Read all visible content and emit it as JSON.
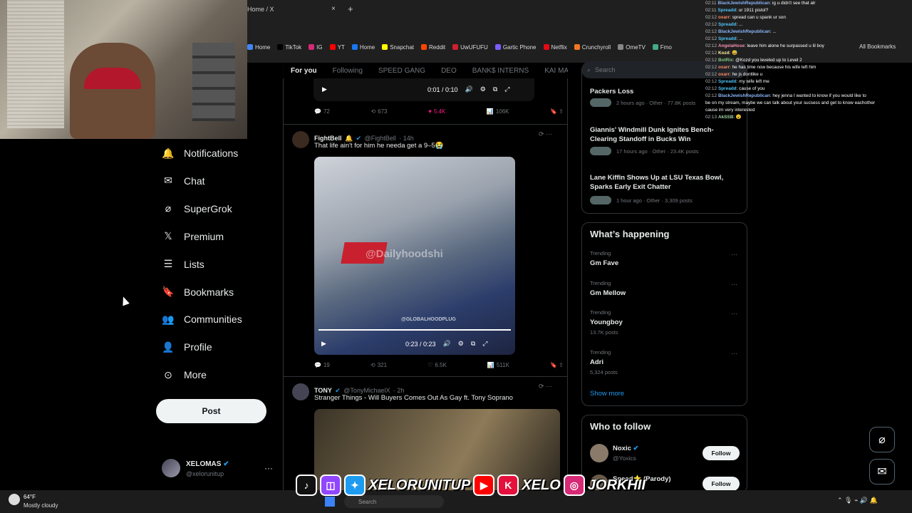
{
  "browser": {
    "tab_title": "Home / X",
    "tab_close": "×",
    "tab_new": "+",
    "bookmarks": [
      {
        "label": "Home",
        "color": "#4285f4"
      },
      {
        "label": "TikTok",
        "color": "#000000"
      },
      {
        "label": "IG",
        "color": "#d62976"
      },
      {
        "label": "YT",
        "color": "#ff0000"
      },
      {
        "label": "Home",
        "color": "#1877f2"
      },
      {
        "label": "Snapchat",
        "color": "#fffc00"
      },
      {
        "label": "Reddit",
        "color": "#ff4500"
      },
      {
        "label": "UwUFUFU",
        "color": "#d01f2e"
      },
      {
        "label": "Gartic Phone",
        "color": "#7b5cff"
      },
      {
        "label": "Netflix",
        "color": "#e50914"
      },
      {
        "label": "Crunchyroll",
        "color": "#f47521"
      },
      {
        "label": "OmeTV",
        "color": "#888888"
      },
      {
        "label": "Fmo",
        "color": "#44aa88"
      }
    ],
    "all_bookmarks": "All Bookmarks"
  },
  "nav": {
    "items": [
      {
        "label": "Notifications",
        "icon": "bell-icon"
      },
      {
        "label": "Chat",
        "icon": "mail-icon"
      },
      {
        "label": "SuperGrok",
        "icon": "grok-icon"
      },
      {
        "label": "Premium",
        "icon": "x-logo-icon"
      },
      {
        "label": "Lists",
        "icon": "list-icon"
      },
      {
        "label": "Bookmarks",
        "icon": "bookmark-icon"
      },
      {
        "label": "Communities",
        "icon": "communities-icon"
      },
      {
        "label": "Profile",
        "icon": "person-icon"
      },
      {
        "label": "More",
        "icon": "more-circle-icon"
      }
    ],
    "post_label": "Post",
    "account": {
      "name": "XELOMAS",
      "handle": "@xelorunitup",
      "more": "···"
    }
  },
  "feed": {
    "tabs": [
      "For you",
      "Following",
      "SPEED GANG",
      "DEO",
      "BANK$ INTERNS",
      "KAI MAF"
    ],
    "top_video": {
      "time": "0:01 / 0:10"
    },
    "top_actions": {
      "replies": "72",
      "reposts": "673",
      "likes": "5.4K",
      "views": "106K"
    },
    "tweets": [
      {
        "name": "FightBell",
        "handle": "@FightBell",
        "time": "· 14h",
        "text": "That life ain't for him he needa get a 9–5😭",
        "video_watermark": "@Dailyhoodshi",
        "video_watermark2": "@GLOBALHOODPLUG",
        "video_time": "0:23 / 0:23",
        "actions": {
          "replies": "19",
          "reposts": "321",
          "likes": "6.5K",
          "views": "511K"
        }
      },
      {
        "name": "TONY",
        "handle": "@TonyMichaelX",
        "time": "· 2h",
        "text": "Stranger Things - Will Buyers Comes Out As Gay ft. Tony Soprano"
      }
    ]
  },
  "sidebar": {
    "search_placeholder": "Search",
    "news": [
      {
        "title": "Packers Loss",
        "meta": "2 hours ago · Other · 77.8K posts"
      },
      {
        "title": "Giannis' Windmill Dunk Ignites Bench-Clearing Standoff in Bucks Win",
        "meta": "17 hours ago · Other · 23.4K posts"
      },
      {
        "title": "Lane Kiffin Shows Up at LSU Texas Bowl, Sparks Early Exit Chatter",
        "meta": "1 hour ago · Other · 3,309 posts"
      }
    ],
    "happening_title": "What’s happening",
    "trends": [
      {
        "label": "Trending",
        "name": "Gm Fave",
        "posts": ""
      },
      {
        "label": "Trending",
        "name": "Gm Mellow",
        "posts": ""
      },
      {
        "label": "Trending",
        "name": "Youngboy",
        "posts": "13.7K posts"
      },
      {
        "label": "Trending",
        "name": "Adri",
        "posts": "5,324 posts"
      }
    ],
    "show_more": "Show more",
    "who_to_follow": "Who to follow",
    "follow_suggestions": [
      {
        "name": "Noxic",
        "handle": "@Yoxics",
        "button": "Follow"
      },
      {
        "name": "Speed⭐ (Parody)",
        "handle": "",
        "button": "Follow"
      }
    ]
  },
  "chat": {
    "lines": [
      {
        "time": "02:11",
        "user": "BlackJewishRepublican",
        "user_color": "#8ab4f8",
        "msg": "ig u didn't see that alr"
      },
      {
        "time": "02:11",
        "user": "Spreadd",
        "user_color": "#4fc3f7",
        "msg": "ur 1911 pistol?"
      },
      {
        "time": "02:12",
        "user": "oxarr",
        "user_color": "#ff8a65",
        "msg": "spread can u spank ur son"
      },
      {
        "time": "02:12",
        "user": "Spreadd",
        "user_color": "#4fc3f7",
        "msg": "..."
      },
      {
        "time": "02:12",
        "user": "BlackJewishRepublican",
        "user_color": "#8ab4f8",
        "msg": "..."
      },
      {
        "time": "02:12",
        "user": "Spreadd",
        "user_color": "#4fc3f7",
        "msg": "..."
      },
      {
        "time": "02:12",
        "user": "AngelaHose",
        "user_color": "#f48fb1",
        "msg": "leave him alone he surpassed u lil boy"
      },
      {
        "time": "02:12",
        "user": "Kozd",
        "user_color": "#fff59d",
        "msg": "😅"
      },
      {
        "time": "02:12",
        "user": "BotRix",
        "user_color": "#81c784",
        "msg": "@Kozd you leveled up to Level 2"
      },
      {
        "time": "02:12",
        "user": "oxarr",
        "user_color": "#ff8a65",
        "msg": "he has time now because his wife left him"
      },
      {
        "time": "02:12",
        "user": "oxarr",
        "user_color": "#ff8a65",
        "msg": "he js dontlike u"
      },
      {
        "time": "02:12",
        "user": "Spreadd",
        "user_color": "#4fc3f7",
        "msg": "my wife left me"
      },
      {
        "time": "02:12",
        "user": "Spreadd",
        "user_color": "#4fc3f7",
        "msg": "cause of you"
      },
      {
        "time": "02:12",
        "user": "BlackJewishRepublican",
        "user_color": "#8ab4f8",
        "msg": "hey jenna I wanted to know if you would like to"
      },
      {
        "time": "",
        "user": "",
        "user_color": "#ffffff",
        "msg": "be on my stream, maybe we can talk about your sucsess and get to know eachother"
      },
      {
        "time": "",
        "user": "",
        "user_color": "#ffffff",
        "msg": "cause im very interested"
      },
      {
        "time": "02:13",
        "user": "AkSSB",
        "user_color": "#a5d6a7",
        "msg": "😮"
      }
    ]
  },
  "banner": {
    "text1": "XELORUNITUP",
    "text2": "XELO",
    "text3": "JORKHII"
  },
  "taskbar": {
    "temp": "64°F",
    "weather": "Mostly cloudy",
    "search": "Search"
  }
}
